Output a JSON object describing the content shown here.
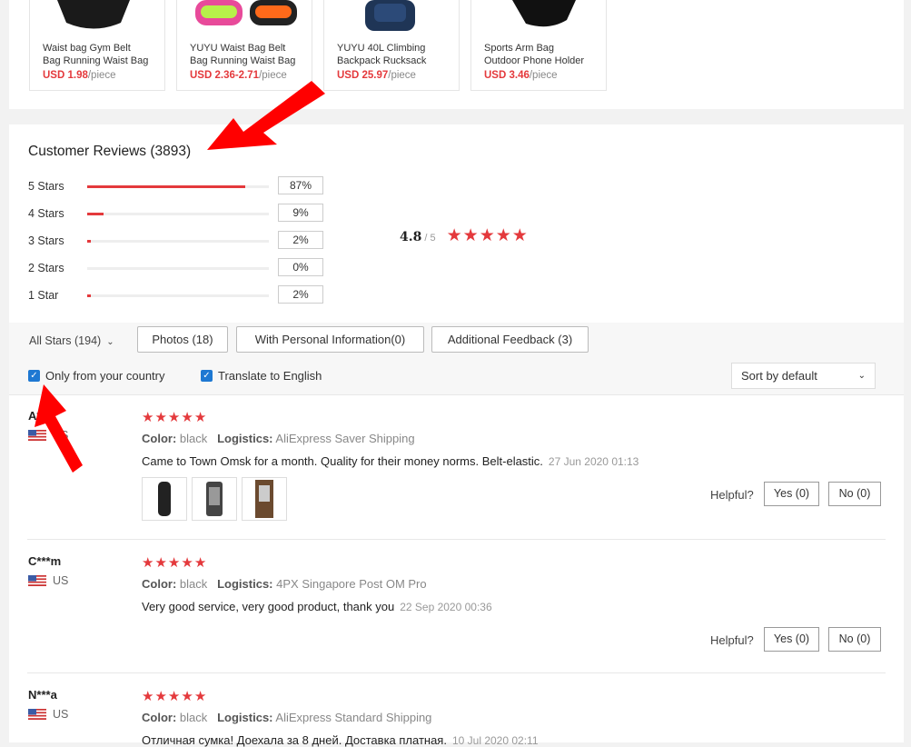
{
  "products": [
    {
      "name_line1": "Waist bag Gym Belt",
      "name_line2": "Bag Running Waist Bag",
      "price": "USD 1.98",
      "unit": "/piece"
    },
    {
      "name_line1": "YUYU Waist Bag Belt",
      "name_line2": "Bag Running Waist Bag",
      "price": "USD 2.36-2.71",
      "unit": "/piece"
    },
    {
      "name_line1": "YUYU 40L Climbing",
      "name_line2": "Backpack Rucksack",
      "price": "USD 25.97",
      "unit": "/piece"
    },
    {
      "name_line1": "Sports Arm Bag",
      "name_line2": "Outdoor Phone Holder",
      "price": "USD 3.46",
      "unit": "/piece"
    }
  ],
  "reviews_header": {
    "title": "Customer Reviews (3893)"
  },
  "rating_distribution": [
    {
      "label": "5 Stars",
      "percent_label": "87%",
      "fraction": 0.87
    },
    {
      "label": "4 Stars",
      "percent_label": "9%",
      "fraction": 0.09
    },
    {
      "label": "3 Stars",
      "percent_label": "2%",
      "fraction": 0.02
    },
    {
      "label": "2 Stars",
      "percent_label": "0%",
      "fraction": 0.0
    },
    {
      "label": "1 Star",
      "percent_label": "2%",
      "fraction": 0.02
    }
  ],
  "overall": {
    "score": "4.8",
    "max": "/ 5",
    "stars": 5
  },
  "filters": {
    "all_stars": "All Stars (194)",
    "photos": "Photos (18)",
    "personal_info": "With Personal Information(0)",
    "additional": "Additional Feedback (3)",
    "only_country": "Only from your country",
    "translate": "Translate to English",
    "sort": "Sort by default"
  },
  "reviews": [
    {
      "user": "A***",
      "country": "US",
      "stars": 5,
      "color_label": "Color:",
      "color": "black",
      "logistics_label": "Logistics:",
      "logistics": "AliExpress Saver Shipping",
      "text": "Came to Town Omsk for a month. Quality for their money norms. Belt-elastic.",
      "date": "27 Jun 2020 01:13",
      "helpful_label": "Helpful?",
      "yes": "Yes (0)",
      "no": "No (0)"
    },
    {
      "user": "C***m",
      "country": "US",
      "stars": 5,
      "color_label": "Color:",
      "color": "black",
      "logistics_label": "Logistics:",
      "logistics": "4PX Singapore Post OM Pro",
      "text": "Very good service, very good product, thank you",
      "date": "22 Sep 2020 00:36",
      "helpful_label": "Helpful?",
      "yes": "Yes (0)",
      "no": "No (0)"
    },
    {
      "user": "N***a",
      "country": "US",
      "stars": 5,
      "color_label": "Color:",
      "color": "black",
      "logistics_label": "Logistics:",
      "logistics": "AliExpress Standard Shipping",
      "text": "Отличная сумка! Доехала за 8 дней. Доставка платная.",
      "date": "10 Jul 2020 02:11"
    }
  ],
  "colors": {
    "accent": "#e4393c",
    "checkbox": "#1e78d2",
    "annotation_arrow": "#ff0000"
  }
}
